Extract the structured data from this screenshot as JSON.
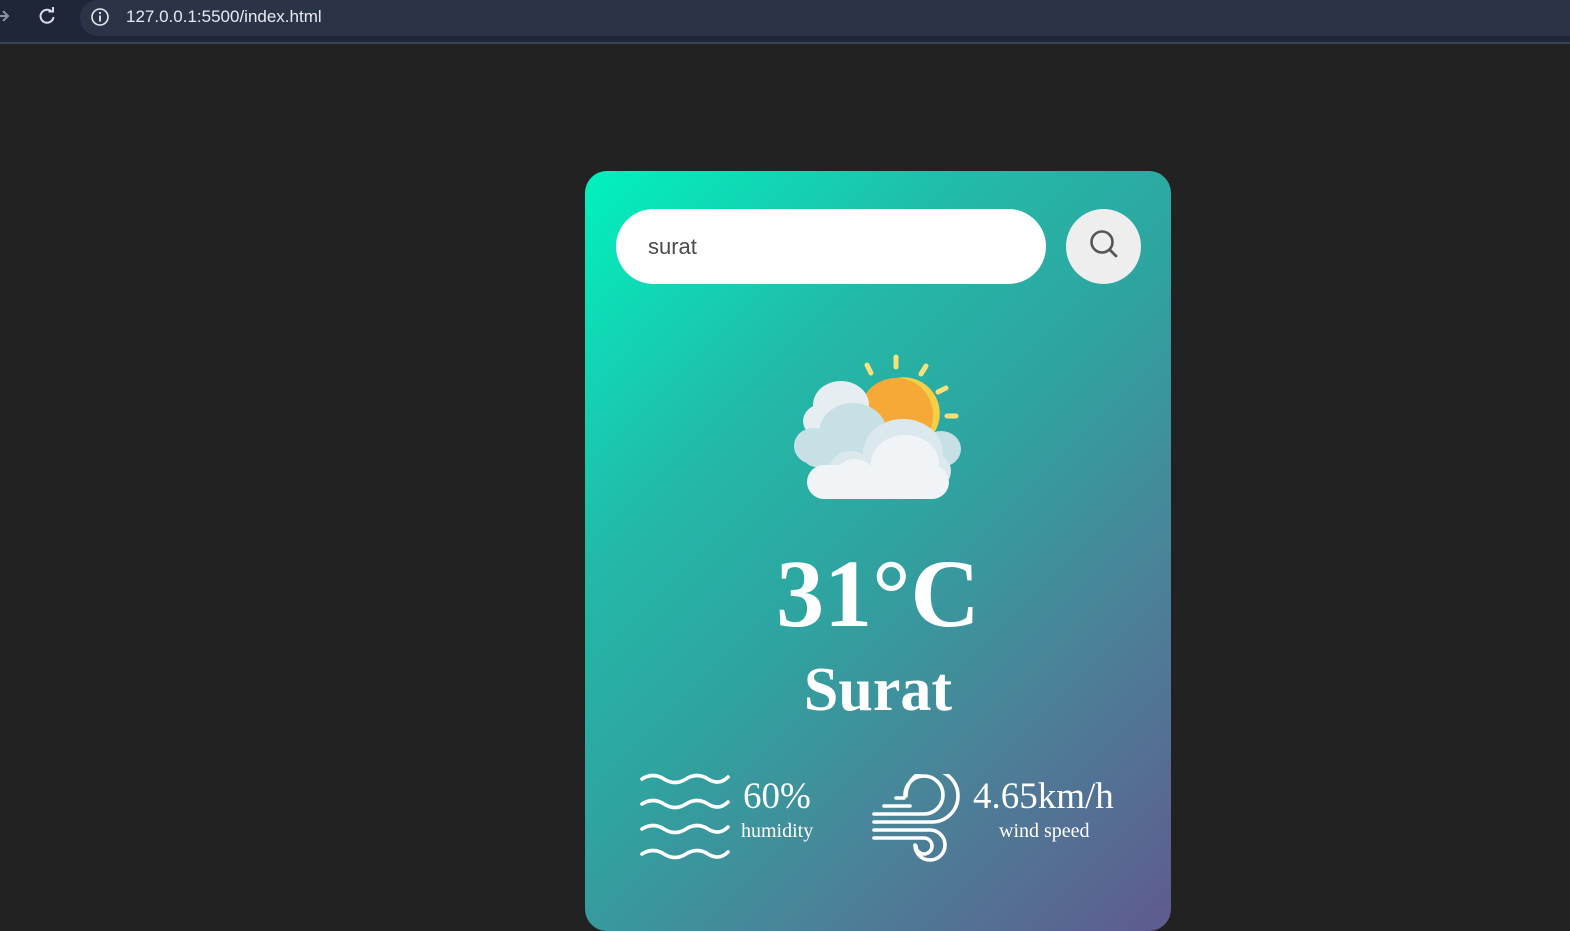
{
  "browser": {
    "url_host": "127.0.0.1",
    "url_path": ":5500/index.html",
    "icons": [
      "forward-arrow-icon",
      "reload-icon",
      "site-info-icon"
    ]
  },
  "weather": {
    "search_value": "surat",
    "temperature": "31°C",
    "city": "Surat",
    "humidity": "60%",
    "humidity_label": "humidity",
    "wind_speed": "4.65km/h",
    "wind_label": "wind speed",
    "condition_icon": "partly-cloudy-icon"
  },
  "colors": {
    "page_background": "#222222",
    "card_gradient_start": "#00f2be",
    "card_gradient_end": "#5f5a8f",
    "text": "#ffffff"
  }
}
